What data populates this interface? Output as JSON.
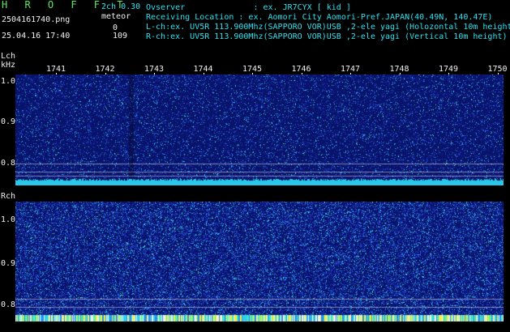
{
  "header": {
    "app_name": "H R O F F T",
    "mode": "2ch 0.30",
    "filename": "2504161740.png",
    "meteor_label": "meteor",
    "meteor_l": "0",
    "meteor_r": "109",
    "datetime": "25.04.16 17:40",
    "observer": "Ovserver              : ex. JR7CYX [ kid ]",
    "location": "Receiving Location : ex. Aomori City Aomori-Pref.JAPAN(40.49N, 140.47E)",
    "lch_info": "L-ch:ex. UV5R 113.900Mhz(SAPPORO VOR)USB ,2-ele yagi (Holozontal 10m height)",
    "rch_info": "R-ch:ex. UV5R 113.900Mhz(SAPPORO VOR)USB ,2-ele yagi (Vertical 10m height)"
  },
  "lch": {
    "label": "Lch",
    "unit": "kHz",
    "freq_ticks": [
      "1.0",
      "0.9",
      "0.8"
    ]
  },
  "rch": {
    "label": "Rch",
    "freq_ticks": [
      "1.0",
      "0.9",
      "0.8"
    ]
  },
  "time_ticks": [
    "1741",
    "1742",
    "1743",
    "1744",
    "1745",
    "1746",
    "1747",
    "1748",
    "1749",
    "1750"
  ],
  "colors": {
    "background": "#000000",
    "noise_base": "#0a1a7a",
    "label_cyan": "#2ee0ee",
    "label_green": "#5ee85e",
    "text_white": "#f0f0f0"
  }
}
